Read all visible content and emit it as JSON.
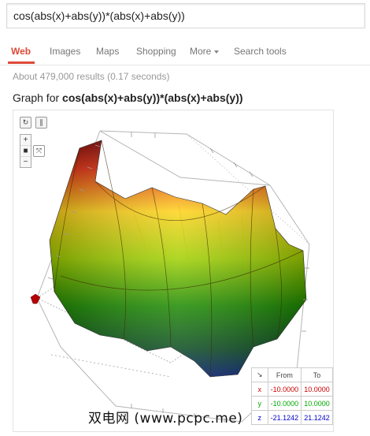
{
  "search": {
    "query": "cos(abs(x)+abs(y))*(abs(x)+abs(y))"
  },
  "tabs": [
    {
      "label": "Web",
      "active": true
    },
    {
      "label": "Images"
    },
    {
      "label": "Maps"
    },
    {
      "label": "Shopping"
    },
    {
      "label": "More"
    },
    {
      "label": "Search tools"
    }
  ],
  "results": {
    "stats": "About 479,000 results (0.17 seconds)"
  },
  "graph": {
    "title_prefix": "Graph for ",
    "title_function": "cos(abs(x)+abs(y))*(abs(x)+abs(y))",
    "controls": {
      "reset_icon": "refresh-icon",
      "pause_icon": "pause-icon",
      "zoom_in": "+",
      "zoom_out": "−",
      "camera_icon": "camera-icon",
      "axes_icon": "axes-icon"
    },
    "range_table": {
      "headers": [
        "From",
        "To"
      ],
      "corner_icon": "arrow-icon",
      "rows": [
        {
          "axis": "x",
          "from": "-10.0000",
          "to": "10.0000",
          "color": "#cc0000"
        },
        {
          "axis": "y",
          "from": "-10.0000",
          "to": "10.0000",
          "color": "#00aa00"
        },
        {
          "axis": "z",
          "from": "-21.1242",
          "to": "21.1242",
          "color": "#0000cc"
        }
      ]
    }
  },
  "watermark": "双电网 (www.pcpc.me)"
}
